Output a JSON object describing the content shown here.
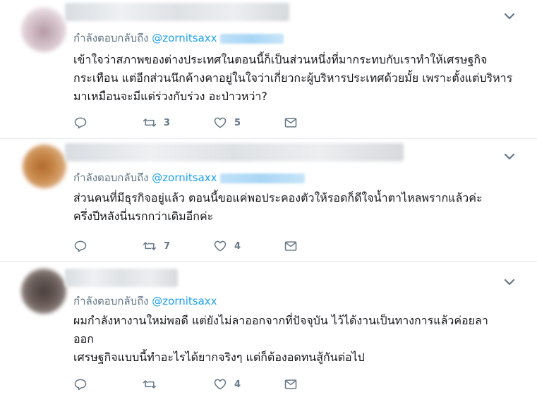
{
  "tweets": [
    {
      "replying_prefix": "กำลังตอบกลับถึง",
      "mention": "@zornitsaxx",
      "lines": [
        "เข้าใจว่าสภาพของต่างประเทศในตอนนี้ก็เป็นส่วนหนึ่งที่มากระทบกับเราทำให้เศรษฐกิจ",
        "กระเทือน แต่อีกส่วนนึกค้างคาอยู่ในใจว่าเกี่ยวกะผู้บริหารประเทศด้วยมั้ย เพราะตั้งแต่บริหาร",
        "มาเหมือนจะมีแต่ร่วงกับร่วง อะป่าวหว่า?"
      ],
      "retweets": "3",
      "likes": "5"
    },
    {
      "replying_prefix": "กำลังตอบกลับถึง",
      "mention": "@zornitsaxx",
      "lines": [
        "ส่วนคนที่มีธุรกิจอยู่แล้ว  ตอนนี้ขอแค่พอประคองตัวให้รอดก็ดีใจน้ำตาไหลพรากแล้วค่ะ",
        "ครึ่งปีหลังนี่นรกกว่าเดิมอีกค่ะ"
      ],
      "retweets": "7",
      "likes": "4"
    },
    {
      "replying_prefix": "กำลังตอบกลับถึง",
      "mention": "@zornitsaxx",
      "lines": [
        "ผมกำลังหางานใหม่พอดี แต่ยังไม่ลาออกจากที่ปัจจุบัน ไว้ได้งานเป็นทางการแล้วค่อยลา",
        "ออก",
        "เศรษฐกิจแบบนี้ทำอะไรได้ยากจริงๆ แต่ก็ต้องอดทนสู้กันต่อไป"
      ],
      "retweets": "",
      "likes": "4"
    }
  ],
  "icons": {
    "reply": "reply-icon",
    "retweet": "retweet-icon",
    "like": "heart-icon",
    "dm": "envelope-icon",
    "caret": "chevron-down-icon"
  },
  "colors": {
    "mention": "#1da1f2",
    "secondary_text": "#657786",
    "divider": "#e6ecf0"
  }
}
